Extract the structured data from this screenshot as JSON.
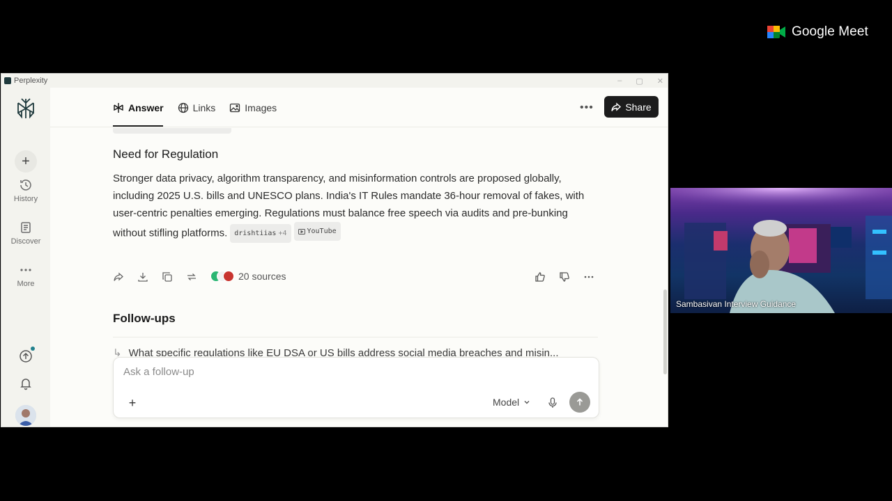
{
  "meet": {
    "brand": "Google Meet",
    "participant_name": "Sambasivan Interview Guidance"
  },
  "window": {
    "app_title": "Perplexity"
  },
  "sidebar": {
    "items": [
      {
        "label": "History",
        "icon": "history-icon"
      },
      {
        "label": "Discover",
        "icon": "discover-icon"
      },
      {
        "label": "More",
        "icon": "more-icon"
      }
    ]
  },
  "header": {
    "tabs": [
      {
        "label": "Answer",
        "icon": "perplexity-icon",
        "active": true
      },
      {
        "label": "Links",
        "icon": "globe-icon",
        "active": false
      },
      {
        "label": "Images",
        "icon": "image-icon",
        "active": false
      }
    ],
    "share_label": "Share"
  },
  "answer": {
    "section_title": "Need for Regulation",
    "paragraph": "Stronger data privacy, algorithm transparency, and misinformation controls are proposed globally, including 2025 U.S. bills and UNESCO plans. India's IT Rules mandate 36-hour removal of fakes, with user-centric penalties emerging. Regulations must balance free speech via audits and pre-bunking without stifling platforms.",
    "citation_1": "drishtiias",
    "citation_1_more": "+4",
    "citation_2": "YouTube",
    "sources_label": "20 sources"
  },
  "followups": {
    "title": "Follow-ups",
    "first_item": "What specific regulations like EU DSA or US bills address social media breaches and misin..."
  },
  "composer": {
    "placeholder": "Ask a follow-up",
    "model_label": "Model"
  },
  "colors": {
    "accent": "#20808d",
    "share_bg": "#1c1c1c",
    "page_bg": "#fcfcf9",
    "sidebar_bg": "#f3f3ee"
  }
}
